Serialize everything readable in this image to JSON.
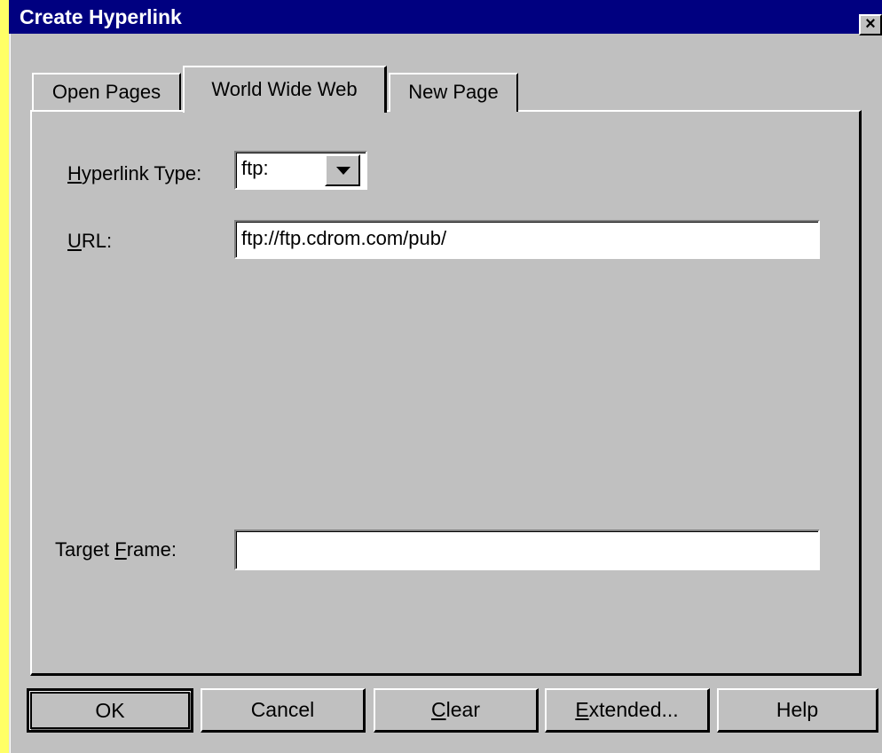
{
  "dialog": {
    "title": "Create Hyperlink",
    "close_glyph": "×"
  },
  "tabs": [
    {
      "label": "Open Pages",
      "active": false
    },
    {
      "label": "World Wide Web",
      "active": true
    },
    {
      "label": "New Page",
      "active": false
    }
  ],
  "form": {
    "hyperlink_type": {
      "label_prefix": "",
      "label_mnemonic": "H",
      "label_rest": "yperlink Type:",
      "value": "ftp:"
    },
    "url": {
      "label_mnemonic": "U",
      "label_rest": "RL:",
      "value": "ftp://ftp.cdrom.com/pub/"
    },
    "target_frame": {
      "label_prefix": "Target ",
      "label_mnemonic": "F",
      "label_rest": "rame:",
      "value": ""
    }
  },
  "buttons": {
    "ok": "OK",
    "cancel": "Cancel",
    "clear_mnemonic": "C",
    "clear_rest": "lear",
    "extended_mnemonic": "E",
    "extended_rest": "xtended...",
    "help": "Help"
  },
  "colors": {
    "background": "#ffff66",
    "titlebar": "#000080",
    "face": "#c0c0c0"
  },
  "icons": {
    "close": "close-icon",
    "dropdown": "chevron-down-icon"
  }
}
